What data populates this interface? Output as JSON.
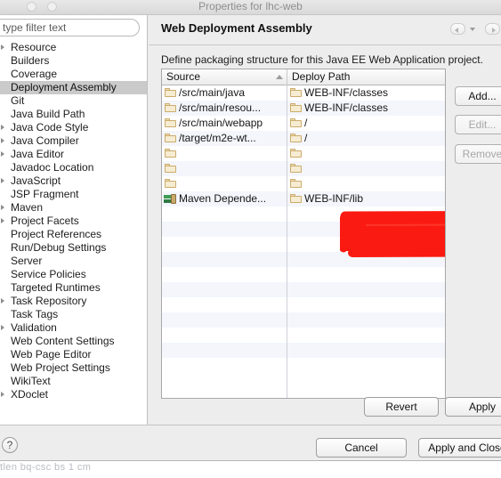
{
  "window": {
    "title": "Properties for lhc-web",
    "traffic_lights": [
      "close",
      "minimize"
    ]
  },
  "sidebar": {
    "filter": {
      "value": "",
      "placeholder": "type filter text"
    },
    "items": [
      {
        "label": "Resource",
        "expandable": true,
        "selected": false
      },
      {
        "label": "Builders",
        "expandable": false,
        "selected": false
      },
      {
        "label": "Coverage",
        "expandable": false,
        "selected": false
      },
      {
        "label": "Deployment Assembly",
        "expandable": false,
        "selected": true
      },
      {
        "label": "Git",
        "expandable": false,
        "selected": false
      },
      {
        "label": "Java Build Path",
        "expandable": false,
        "selected": false
      },
      {
        "label": "Java Code Style",
        "expandable": true,
        "selected": false
      },
      {
        "label": "Java Compiler",
        "expandable": true,
        "selected": false
      },
      {
        "label": "Java Editor",
        "expandable": true,
        "selected": false
      },
      {
        "label": "Javadoc Location",
        "expandable": false,
        "selected": false
      },
      {
        "label": "JavaScript",
        "expandable": true,
        "selected": false
      },
      {
        "label": "JSP Fragment",
        "expandable": false,
        "selected": false
      },
      {
        "label": "Maven",
        "expandable": true,
        "selected": false
      },
      {
        "label": "Project Facets",
        "expandable": true,
        "selected": false
      },
      {
        "label": "Project References",
        "expandable": false,
        "selected": false
      },
      {
        "label": "Run/Debug Settings",
        "expandable": false,
        "selected": false
      },
      {
        "label": "Server",
        "expandable": false,
        "selected": false
      },
      {
        "label": "Service Policies",
        "expandable": false,
        "selected": false
      },
      {
        "label": "Targeted Runtimes",
        "expandable": false,
        "selected": false
      },
      {
        "label": "Task Repository",
        "expandable": true,
        "selected": false
      },
      {
        "label": "Task Tags",
        "expandable": false,
        "selected": false
      },
      {
        "label": "Validation",
        "expandable": true,
        "selected": false
      },
      {
        "label": "Web Content Settings",
        "expandable": false,
        "selected": false
      },
      {
        "label": "Web Page Editor",
        "expandable": false,
        "selected": false
      },
      {
        "label": "Web Project Settings",
        "expandable": false,
        "selected": false
      },
      {
        "label": "WikiText",
        "expandable": false,
        "selected": false
      },
      {
        "label": "XDoclet",
        "expandable": true,
        "selected": false
      }
    ]
  },
  "panel": {
    "title": "Web Deployment Assembly",
    "description": "Define packaging structure for this Java EE Web Application project.",
    "nav_back": "back-arrow",
    "nav_forward": "forward-arrow",
    "nav_menu": "history-dropdown"
  },
  "table": {
    "columns": [
      {
        "label": "Source",
        "sort": "ascending"
      },
      {
        "label": "Deploy Path",
        "sort": "none"
      }
    ],
    "rows": [
      {
        "icon": "folder-icon",
        "source": "/src/main/java",
        "deploy_icon": "folder-icon",
        "deploy": "WEB-INF/classes",
        "redacted": false
      },
      {
        "icon": "folder-icon",
        "source": "/src/main/resou...",
        "deploy_icon": "folder-icon",
        "deploy": "WEB-INF/classes",
        "redacted": false
      },
      {
        "icon": "folder-icon",
        "source": "/src/main/webapp",
        "deploy_icon": "folder-icon",
        "deploy": "/",
        "redacted": false
      },
      {
        "icon": "folder-icon",
        "source": "/target/m2e-wt...",
        "deploy_icon": "folder-icon",
        "deploy": "/",
        "redacted": false
      },
      {
        "icon": "folder-icon",
        "source": "",
        "deploy_icon": "folder-icon",
        "deploy": "",
        "redacted": true
      },
      {
        "icon": "folder-icon",
        "source": "",
        "deploy_icon": "folder-icon",
        "deploy": "",
        "redacted": true
      },
      {
        "icon": "folder-icon",
        "source": "",
        "deploy_icon": "folder-icon",
        "deploy": "",
        "redacted": true
      },
      {
        "icon": "maven-dependencies-icon",
        "source": "Maven Depende...",
        "deploy_icon": "folder-icon",
        "deploy": "WEB-INF/lib",
        "redacted": false
      }
    ],
    "empty_row_count": 11
  },
  "actions": {
    "add_label": "Add...",
    "edit_label": "Edit...",
    "remove_label": "Remove",
    "edit_enabled": false,
    "remove_enabled": false,
    "revert_label": "Revert",
    "apply_label": "Apply"
  },
  "footer": {
    "help_label": "?",
    "cancel_label": "Cancel",
    "apply_and_close_label": "Apply and Close"
  },
  "background": {
    "faint_text": "tlen  bq-csc bs 1 cm"
  },
  "colors": {
    "redaction": "#fb1a11",
    "selection": "#cacaca",
    "row_alt": "#f4f6fc",
    "dialog_bg": "#ededed"
  }
}
